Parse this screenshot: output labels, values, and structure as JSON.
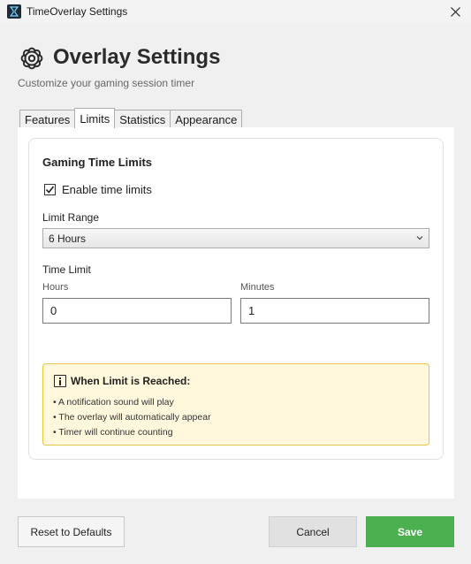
{
  "window": {
    "title": "TimeOverlay Settings"
  },
  "header": {
    "icon": "gear-icon",
    "title": "Overlay Settings",
    "subtitle": "Customize your gaming session timer"
  },
  "tabs": [
    {
      "label": "Features",
      "active": false
    },
    {
      "label": "Limits",
      "active": true
    },
    {
      "label": "Statistics",
      "active": false
    },
    {
      "label": "Appearance",
      "active": false
    }
  ],
  "limits": {
    "section_title": "Gaming Time Limits",
    "enable_checkbox": {
      "label": "Enable time limits",
      "checked": true
    },
    "limit_range": {
      "label": "Limit Range",
      "selected": "6 Hours"
    },
    "time_limit": {
      "label": "Time Limit",
      "hours_label": "Hours",
      "hours_value": "0",
      "minutes_label": "Minutes",
      "minutes_value": "1"
    },
    "info": {
      "icon": "info-icon",
      "title": "When Limit is Reached:",
      "items": [
        "• A notification sound will play",
        "• The overlay will automatically appear",
        "• Timer will continue counting"
      ]
    }
  },
  "footer": {
    "reset_label": "Reset to Defaults",
    "cancel_label": "Cancel",
    "save_label": "Save"
  },
  "colors": {
    "save_button": "#4caf50",
    "info_background": "#fff8dc",
    "info_border": "#e8c547"
  }
}
